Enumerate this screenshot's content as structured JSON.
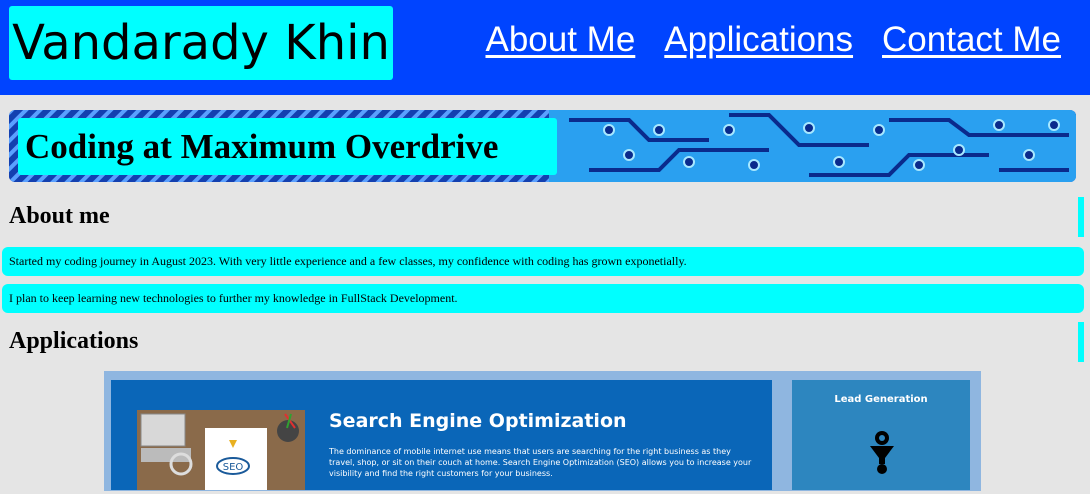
{
  "header": {
    "brand": "Vandarady Khin",
    "nav": [
      {
        "label": "About Me"
      },
      {
        "label": "Applications"
      },
      {
        "label": "Contact Me"
      }
    ]
  },
  "hero": {
    "title": "Coding at Maximum Overdrive"
  },
  "about": {
    "heading": "About me",
    "paragraphs": [
      "Started my coding journey in August 2023. With very little experience and a few classes, my confidence with coding has grown exponetially.",
      "I plan to keep learning new technologies to further my knowledge in FullStack Development."
    ]
  },
  "applications": {
    "heading": "Applications",
    "preview": {
      "title": "Search Engine Optimization",
      "description": "The dominance of mobile internet use means that users are searching for the right business as they travel, shop, or sit on their couch at home. Search Engine Optimization (SEO) allows you to increase your visibility and find the right customers for your business.",
      "side_title": "Lead Generation",
      "photo_label": "SEO"
    }
  },
  "colors": {
    "header_bg": "#0044ff",
    "accent": "#00ffff",
    "page_bg": "#e5e5e5"
  }
}
